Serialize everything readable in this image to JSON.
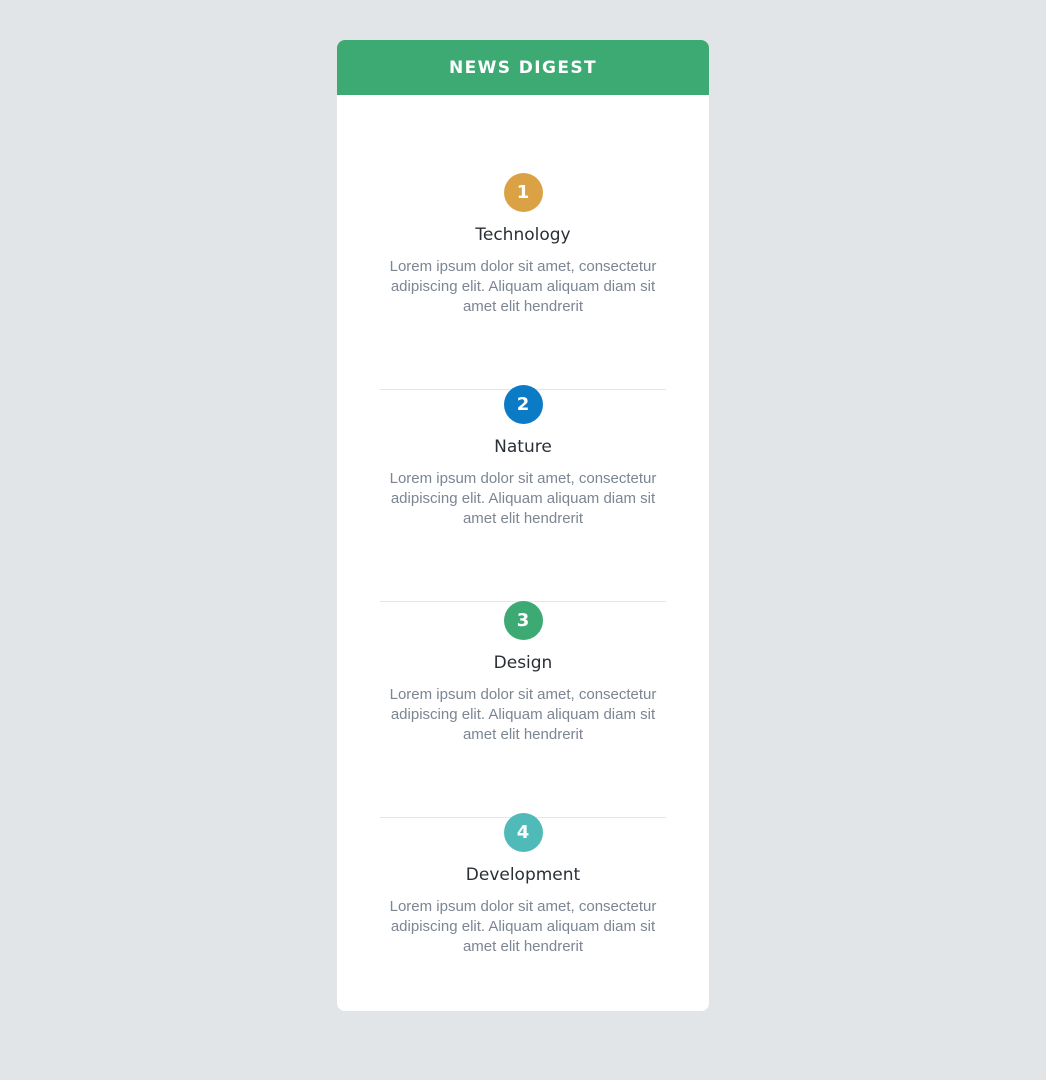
{
  "digest": {
    "title": "NEWS DIGEST",
    "accent_color": "#3eaa73",
    "items": [
      {
        "number": "1",
        "title": "Technology",
        "description": "Lorem ipsum dolor sit amet, consectetur adipiscing elit. Aliquam aliquam diam sit amet elit hendrerit",
        "color": "#dba245"
      },
      {
        "number": "2",
        "title": "Nature",
        "description": "Lorem ipsum dolor sit amet, consectetur adipiscing elit. Aliquam aliquam diam sit amet elit hendrerit",
        "color": "#0a7bc4"
      },
      {
        "number": "3",
        "title": "Design",
        "description": "Lorem ipsum dolor sit amet, consectetur adipiscing elit. Aliquam aliquam diam sit amet elit hendrerit",
        "color": "#3eaa73"
      },
      {
        "number": "4",
        "title": "Development",
        "description": "Lorem ipsum dolor sit amet, consectetur adipiscing elit. Aliquam aliquam diam sit amet elit hendrerit",
        "color": "#4fbab8"
      }
    ]
  }
}
